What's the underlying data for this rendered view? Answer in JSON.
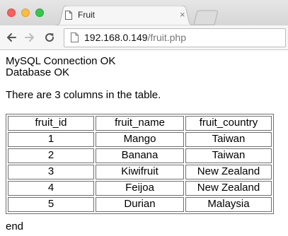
{
  "window": {
    "tab_title": "Fruit"
  },
  "tab": {
    "close_glyph": "×"
  },
  "toolbar": {
    "url_host": "192.168.0.149",
    "url_path": "/fruit.php"
  },
  "page": {
    "status_line_1": "MySQL Connection OK",
    "status_line_2": "Database OK",
    "column_info": "There are 3 columns in the table.",
    "footer": "end"
  },
  "table": {
    "headers": [
      "fruit_id",
      "fruit_name",
      "fruit_country"
    ],
    "rows": [
      [
        "1",
        "Mango",
        "Taiwan"
      ],
      [
        "2",
        "Banana",
        "Taiwan"
      ],
      [
        "3",
        "Kiwifruit",
        "New Zealand"
      ],
      [
        "4",
        "Feijoa",
        "New Zealand"
      ],
      [
        "5",
        "Durian",
        "Malaysia"
      ]
    ]
  },
  "icons": {
    "close": "close-icon",
    "minimize": "minimize-icon",
    "maximize": "maximize-icon",
    "back": "back-arrow-icon",
    "forward": "forward-arrow-icon",
    "reload": "reload-icon",
    "page": "page-icon",
    "favicon": "document-icon"
  },
  "colors": {
    "close": "#fc605c",
    "minimize": "#fdbc40",
    "maximize": "#34c84a",
    "url_path": "#777777"
  }
}
